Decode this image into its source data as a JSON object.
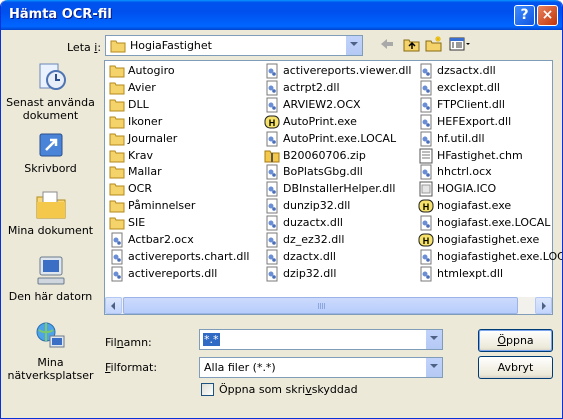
{
  "window": {
    "title": "Hämta OCR-fil",
    "help": "?",
    "close": "×"
  },
  "lookin": {
    "label_pre": "Leta ",
    "label_ul": "i",
    "label_post": ":",
    "value": "HogiaFastighet"
  },
  "places": [
    {
      "label": "Senast använda dokument",
      "icon": "recent-documents-icon"
    },
    {
      "label": "Skrivbord",
      "icon": "desktop-icon"
    },
    {
      "label": "Mina dokument",
      "icon": "my-documents-icon"
    },
    {
      "label": "Den här datorn",
      "icon": "my-computer-icon"
    },
    {
      "label": "Mina nätverksplatser",
      "icon": "network-places-icon"
    }
  ],
  "files": [
    [
      "Autogiro",
      "Avier",
      "DLL",
      "Ikoner",
      "Journaler",
      "Krav",
      "Mallar",
      "OCR",
      "Påminnelser",
      "SIE",
      "Actbar2.ocx",
      "activereports.chart.dll",
      "activereports.dll"
    ],
    [
      "activereports.viewer.dll",
      "actrpt2.dll",
      "ARVIEW2.OCX",
      "AutoPrint.exe",
      "AutoPrint.exe.LOCAL",
      "B20060706.zip",
      "BoPlatsGbg.dll",
      "DBInstallerHelper.dll",
      "dunzip32.dll",
      "duzactx.dll",
      "dz_ez32.dll",
      "dzactx.dll",
      "dzip32.dll"
    ],
    [
      "dzsactx.dll",
      "exclexpt.dll",
      "FTPClient.dll",
      "HEFExport.dll",
      "hf.util.dll",
      "HFastighet.chm",
      "hhctrl.ocx",
      "HOGIA.ICO",
      "hogiafast.exe",
      "hogiafast.exe.LOCAL",
      "hogiafastighet.exe",
      "hogiafastighet.exe.LOCAL",
      "htmlexpt.dll"
    ]
  ],
  "file_icons": [
    [
      "folder",
      "folder",
      "folder",
      "folder",
      "folder",
      "folder",
      "folder",
      "folder",
      "folder",
      "folder",
      "dll",
      "dll",
      "dll"
    ],
    [
      "dll",
      "dll",
      "dll",
      "hogia-exe",
      "dll",
      "zip",
      "dll",
      "dll",
      "dll",
      "dll",
      "dll",
      "dll",
      "dll"
    ],
    [
      "dll",
      "dll",
      "dll",
      "dll",
      "dll",
      "chm",
      "dll",
      "ico",
      "hogia-exe",
      "dll",
      "hogia-exe",
      "dll",
      "dll"
    ]
  ],
  "filename": {
    "label_pre": "Fil",
    "label_ul": "n",
    "label_post": "amn:",
    "value": "*.*"
  },
  "filetype": {
    "label_pre": "",
    "label_ul": "F",
    "label_post": "ilformat:",
    "value": "Alla filer (*.*)"
  },
  "buttons": {
    "open_ul": "Ö",
    "open_post": "ppna",
    "cancel": "Avbryt"
  },
  "readonly": {
    "label_pre": "Öppna som skri",
    "label_ul": "v",
    "label_post": "skyddad",
    "checked": false
  }
}
